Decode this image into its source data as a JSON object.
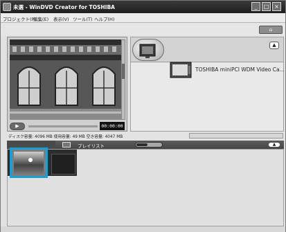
{
  "window": {
    "title": "未選 - WinDVD Creator for TOSHIBA",
    "minimize_glyph": "_",
    "maximize_glyph": "□",
    "close_glyph": "×"
  },
  "menu": {
    "items": [
      "プロジェクト(P)",
      "編集(E)",
      "表示(V)",
      "ツール(T)",
      "ヘルプ(H)"
    ]
  },
  "toolbar": {
    "home_glyph": "⌂"
  },
  "preview": {
    "play_glyph": "▶",
    "timecode": "00:00:00"
  },
  "device_pane": {
    "up_glyph": "▲",
    "device_label": "TOSHIBA miniPCI WDM Video Ca..."
  },
  "status": {
    "disk_info": "ディスク容量: 4096 MB 使用容量: 49 MB 空き容量: 4047 MB"
  },
  "playlist": {
    "label": "プレイリスト",
    "collapse_glyph": "▲"
  },
  "icons": {
    "app": "app-icon",
    "home": "home-icon",
    "device": "tv-icon",
    "playlist": "playlist-icon"
  },
  "colors": {
    "selection": "#1b9ed2",
    "titlebar": "#2a2a2a"
  }
}
